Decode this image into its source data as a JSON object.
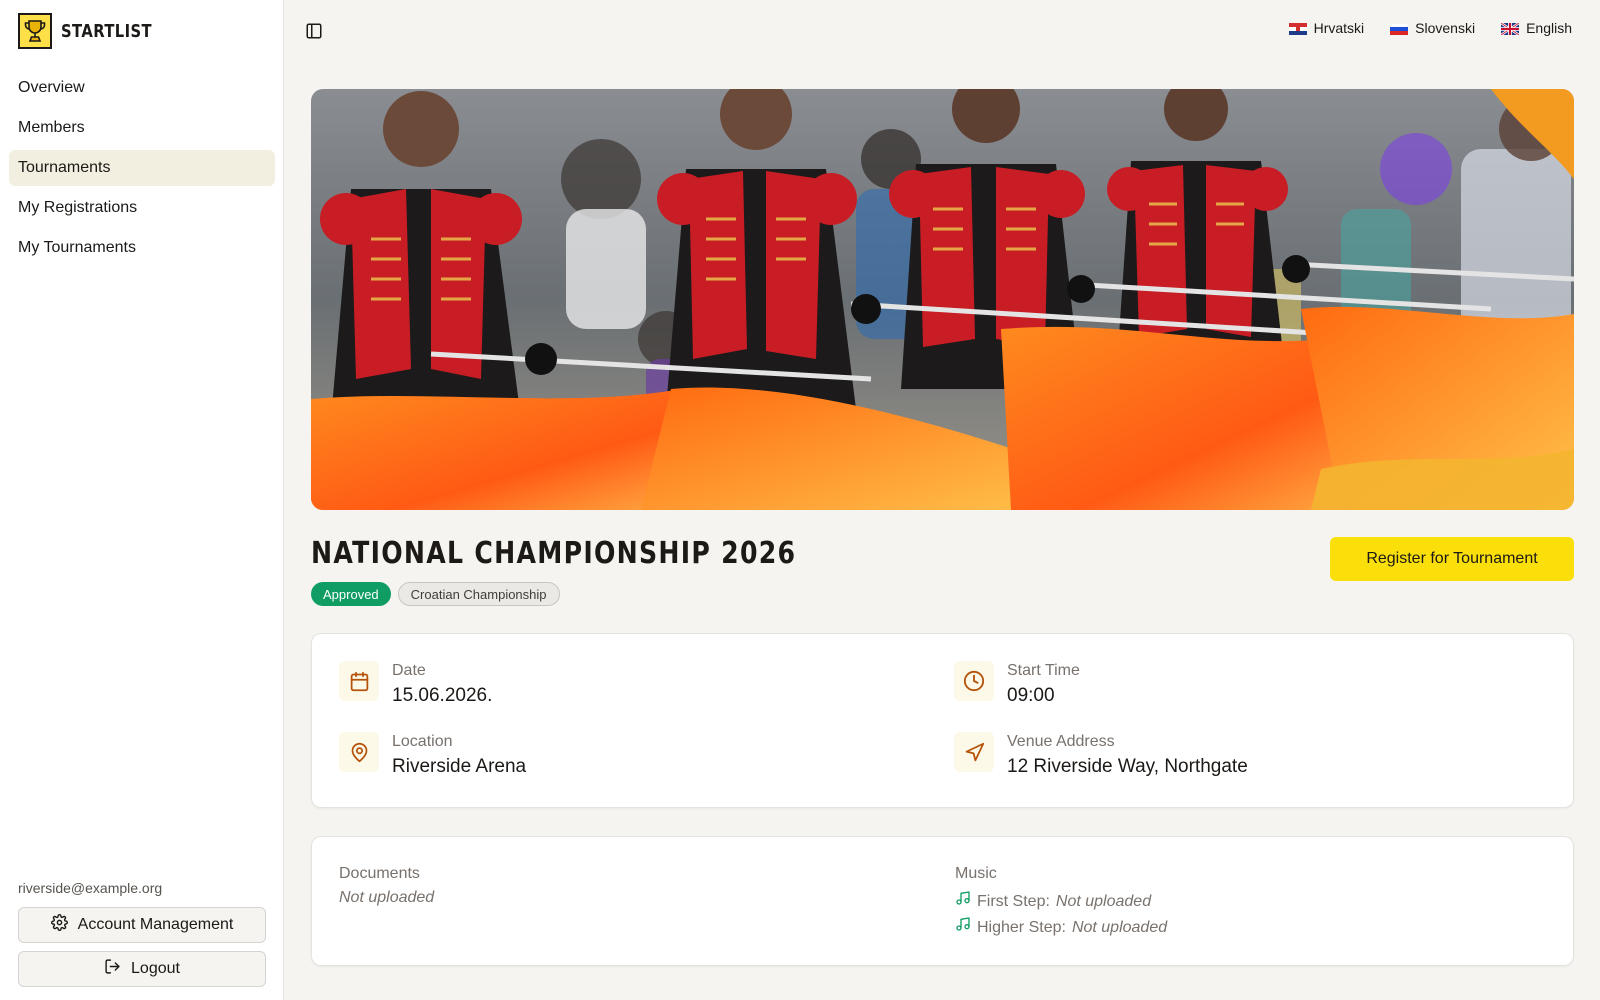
{
  "brand": {
    "name": "STARTLIST",
    "logo_icon": "trophy-icon"
  },
  "sidebar": {
    "items": [
      {
        "label": "Overview",
        "active": false
      },
      {
        "label": "Members",
        "active": false
      },
      {
        "label": "Tournaments",
        "active": true
      },
      {
        "label": "My Registrations",
        "active": false
      },
      {
        "label": "My Tournaments",
        "active": false
      }
    ],
    "user_email": "riverside@example.org",
    "account_label": "Account Management",
    "logout_label": "Logout"
  },
  "languages": [
    {
      "label": "Hrvatski",
      "flag": "croatia-flag"
    },
    {
      "label": "Slovenski",
      "flag": "slovenia-flag"
    },
    {
      "label": "English",
      "flag": "uk-flag"
    }
  ],
  "hero": {
    "icon": "tournament-banner-photo"
  },
  "tournament": {
    "title": "NATIONAL CHAMPIONSHIP 2026",
    "status": "Approved",
    "category": "Croatian Championship",
    "register_label": "Register for Tournament",
    "details": {
      "date_label": "Date",
      "date": "15.06.2026.",
      "time_label": "Start Time",
      "time": "09:00",
      "location_label": "Location",
      "location": "Riverside Arena",
      "address_label": "Venue Address",
      "address": "12 Riverside Way, Northgate"
    },
    "documents": {
      "label": "Documents",
      "value": "Not uploaded"
    },
    "music": {
      "label": "Music",
      "first_step_label": "First Step:",
      "first_step_value": "Not uploaded",
      "higher_step_label": "Higher Step:",
      "higher_step_value": "Not uploaded"
    }
  },
  "colors": {
    "accent": "#fadf0a",
    "approved": "#0f9d63",
    "active_nav": "#f3efe0",
    "icon": "#b45309"
  }
}
